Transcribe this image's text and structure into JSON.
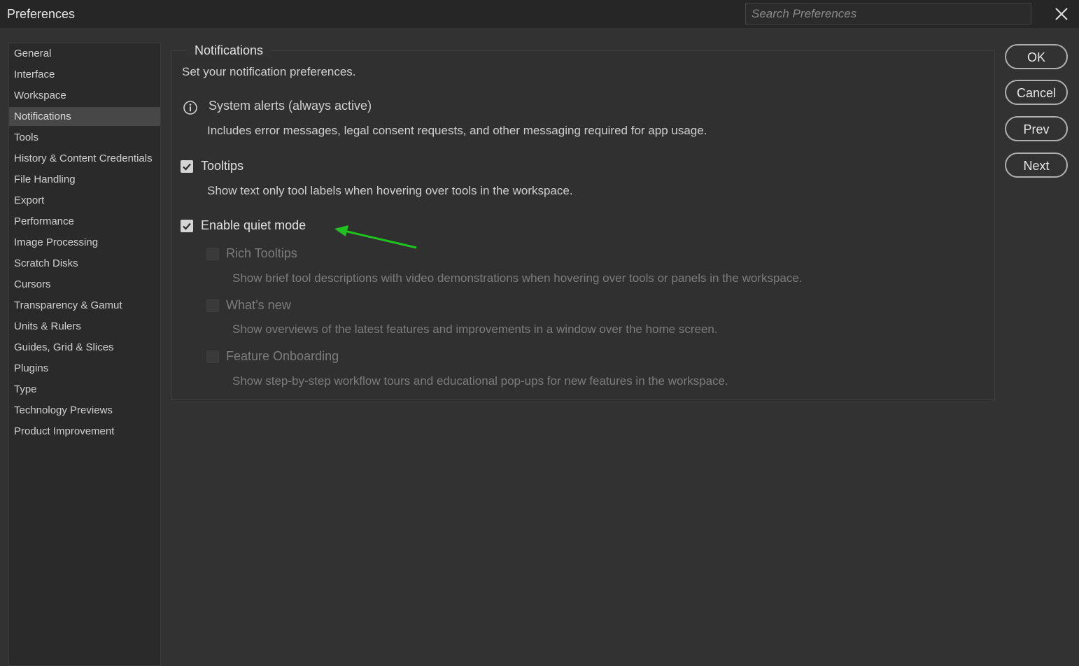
{
  "window": {
    "title": "Preferences"
  },
  "search": {
    "placeholder": "Search Preferences"
  },
  "sidebar": {
    "items": [
      {
        "label": "General"
      },
      {
        "label": "Interface"
      },
      {
        "label": "Workspace"
      },
      {
        "label": "Notifications",
        "selected": true
      },
      {
        "label": "Tools"
      },
      {
        "label": "History & Content Credentials"
      },
      {
        "label": "File Handling"
      },
      {
        "label": "Export"
      },
      {
        "label": "Performance"
      },
      {
        "label": "Image Processing"
      },
      {
        "label": "Scratch Disks"
      },
      {
        "label": "Cursors"
      },
      {
        "label": "Transparency & Gamut"
      },
      {
        "label": "Units & Rulers"
      },
      {
        "label": "Guides, Grid & Slices"
      },
      {
        "label": "Plugins"
      },
      {
        "label": "Type"
      },
      {
        "label": "Technology Previews"
      },
      {
        "label": "Product Improvement"
      }
    ]
  },
  "panel": {
    "legend": "Notifications",
    "subtitle": "Set your notification preferences.",
    "system_alerts": {
      "icon": "info-icon",
      "label": "System alerts (always active)",
      "description": "Includes error messages, legal consent requests, and other messaging required for app usage."
    },
    "tooltips": {
      "label": "Tooltips",
      "checked": true,
      "description": "Show text only tool labels when hovering over tools in the workspace."
    },
    "quiet_mode": {
      "label": "Enable quiet mode",
      "checked": true
    },
    "rich_tooltips": {
      "label": "Rich Tooltips",
      "checked": false,
      "disabled": true,
      "description": "Show brief tool descriptions with video demonstrations when hovering over tools or panels in the workspace."
    },
    "whats_new": {
      "label": "What’s new",
      "checked": false,
      "disabled": true,
      "description": "Show overviews of the latest features and improvements in a window over the home screen."
    },
    "feature_onboarding": {
      "label": "Feature Onboarding",
      "checked": false,
      "disabled": true,
      "description": "Show step-by-step workflow tours and educational pop-ups for new features in the workspace."
    }
  },
  "buttons": {
    "ok": "OK",
    "cancel": "Cancel",
    "prev": "Prev",
    "next": "Next"
  },
  "annotation": {
    "arrow_color": "#1fc21f"
  },
  "colors": {
    "background": "#323232",
    "titlebar": "#262626",
    "sidebar_selected": "#474747"
  }
}
